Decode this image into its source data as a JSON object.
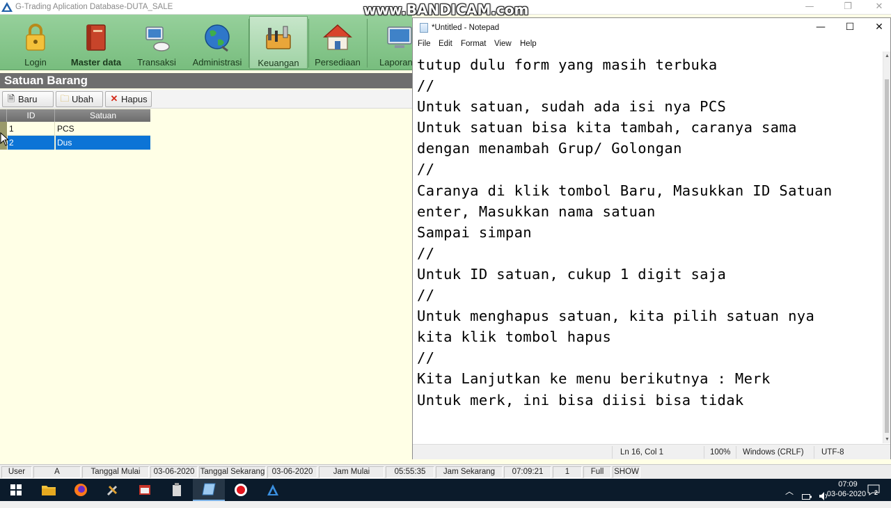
{
  "app": {
    "title": "G-Trading Aplication Database-DUTA_SALE",
    "controls": {
      "minimize": "—",
      "maximize": "❐",
      "close": "✕"
    }
  },
  "watermark": "www.BANDICAM.com",
  "ribbon": {
    "items": [
      {
        "label": "Login",
        "icon": "lock-icon"
      },
      {
        "label": "Master data",
        "icon": "book-icon"
      },
      {
        "label": "Transaksi",
        "icon": "computer-icon"
      },
      {
        "label": "Administrasi",
        "icon": "globe-icon"
      },
      {
        "label": "Keuangan",
        "icon": "tools-icon"
      },
      {
        "label": "Persediaan",
        "icon": "house-icon"
      },
      {
        "label": "Laporan",
        "icon": "monitor-icon"
      }
    ]
  },
  "form": {
    "title": "Satuan Barang",
    "toolbar": {
      "new_label": "Baru",
      "edit_label": "Ubah",
      "delete_label": "Hapus"
    },
    "grid": {
      "columns": [
        "ID",
        "Satuan"
      ],
      "rows": [
        {
          "id": "1",
          "satuan": "PCS",
          "selected": false
        },
        {
          "id": "2",
          "satuan": "Dus",
          "selected": true
        }
      ]
    }
  },
  "statusbar": {
    "cells": [
      "User",
      "A",
      "Tanggal Mulai",
      "03-06-2020",
      "Tanggal Sekarang",
      "03-06-2020",
      "Jam Mulai",
      "05:55:35",
      "Jam Sekarang",
      "07:09:21",
      "1",
      "Full",
      "SHOW"
    ]
  },
  "notepad": {
    "title": "*Untitled - Notepad",
    "menu": [
      "File",
      "Edit",
      "Format",
      "View",
      "Help"
    ],
    "lines": [
      "tutup dulu form yang masih terbuka",
      "//",
      "Untuk satuan, sudah ada isi nya PCS",
      "Untuk satuan bisa kita tambah, caranya sama",
      "dengan menambah Grup/ Golongan",
      "//",
      "Caranya di klik tombol Baru, Masukkan ID Satuan",
      "enter, Masukkan nama satuan",
      "Sampai simpan",
      "//",
      "Untuk ID satuan, cukup 1 digit saja",
      "//",
      "Untuk menghapus satuan, kita pilih satuan nya",
      "kita klik tombol hapus",
      "//",
      "Kita Lanjutkan ke menu berikutnya : Merk",
      "Untuk merk, ini bisa diisi bisa tidak"
    ],
    "status": {
      "position": "Ln 16, Col 1",
      "zoom": "100%",
      "line_ending": "Windows (CRLF)",
      "encoding": "UTF-8"
    }
  },
  "taskbar": {
    "time": "07:09",
    "date": "03-06-2020",
    "notifications": "2"
  }
}
